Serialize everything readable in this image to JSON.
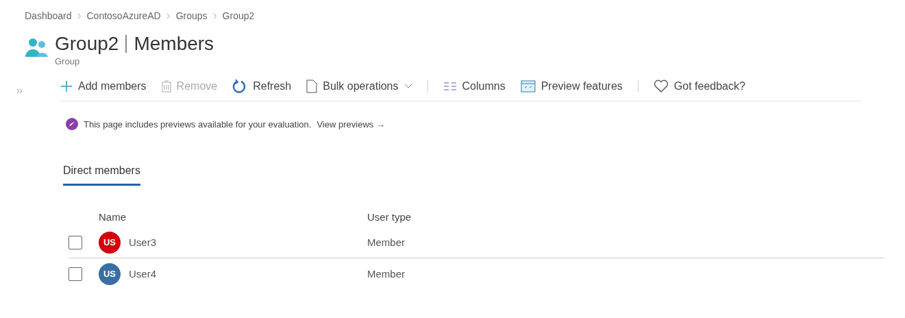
{
  "breadcrumb": [
    "Dashboard",
    "ContosoAzureAD",
    "Groups",
    "Group2"
  ],
  "header": {
    "title": "Group2",
    "section": "Members",
    "subtitle": "Group"
  },
  "toolbar": [
    {
      "kind": "add",
      "label": "Add members",
      "disabled": false
    },
    {
      "kind": "delete",
      "label": "Remove",
      "disabled": true
    },
    {
      "kind": "refresh",
      "label": "Refresh",
      "disabled": false
    },
    {
      "kind": "bulk",
      "label": "Bulk operations",
      "disabled": false
    },
    {
      "kind": "separator"
    },
    {
      "kind": "columns",
      "label": "Columns",
      "disabled": false
    },
    {
      "kind": "preview",
      "label": "Preview features",
      "disabled": false
    },
    {
      "kind": "separator"
    },
    {
      "kind": "feedback",
      "label": "Got feedback?",
      "disabled": false
    }
  ],
  "notice": {
    "text": "This page includes previews available for your evaluation.",
    "link": "View previews →"
  },
  "tabs": [
    {
      "label": "Direct members",
      "selected": true
    }
  ],
  "table": {
    "columns": [
      "Name",
      "User type"
    ],
    "rows": [
      {
        "checked": false,
        "initials": "US",
        "color": "#d4000f",
        "name": "User3",
        "user_type": "Member"
      },
      {
        "checked": false,
        "initials": "US",
        "color": "#3a6ea5",
        "name": "User4",
        "user_type": "Member"
      }
    ]
  }
}
